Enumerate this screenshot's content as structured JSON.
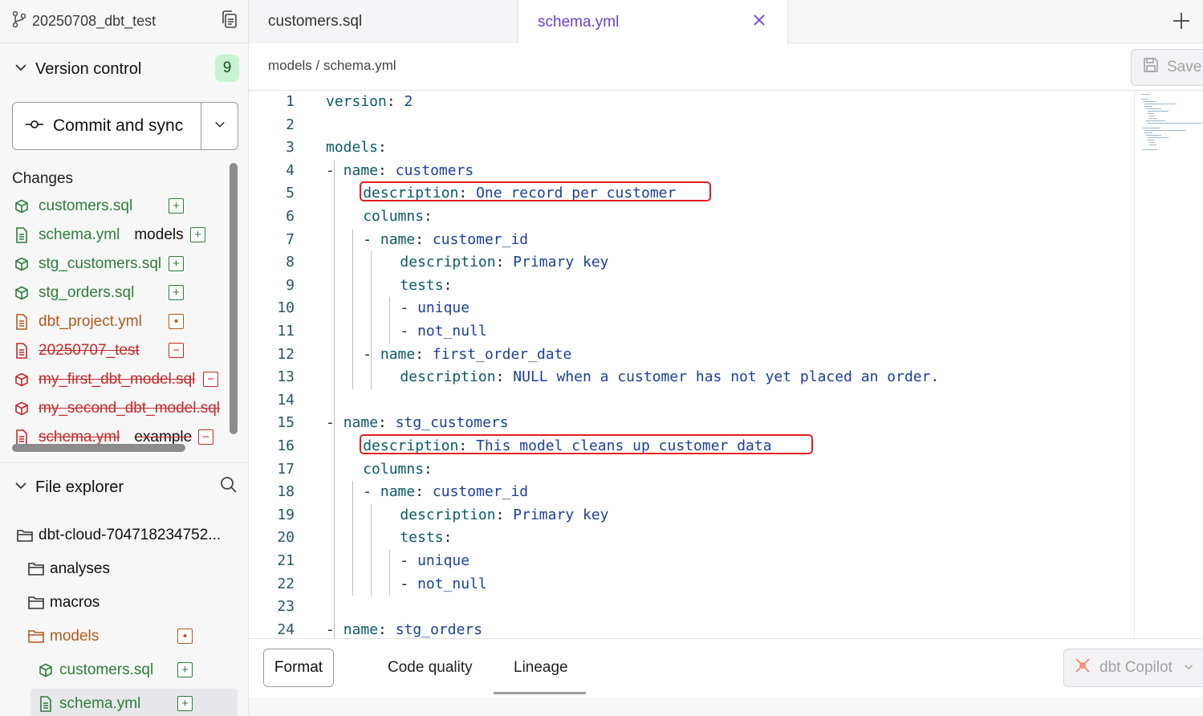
{
  "sidebar": {
    "branch": "20250708_dbt_test",
    "version_control": {
      "title": "Version control",
      "badge": "9"
    },
    "commit": {
      "label": "Commit and sync"
    },
    "changes": {
      "title": "Changes",
      "items": [
        {
          "name": "customers.sql",
          "folder": "",
          "state": "added",
          "kind": "model"
        },
        {
          "name": "schema.yml",
          "folder": "models",
          "state": "added",
          "kind": "file"
        },
        {
          "name": "stg_customers.sql",
          "folder": "",
          "state": "added",
          "kind": "model"
        },
        {
          "name": "stg_orders.sql",
          "folder": "",
          "state": "added",
          "kind": "model"
        },
        {
          "name": "dbt_project.yml",
          "folder": "",
          "state": "modified",
          "kind": "file"
        },
        {
          "name": "20250707_test",
          "folder": "",
          "state": "deleted",
          "kind": "file"
        },
        {
          "name": "my_first_dbt_model.sql",
          "folder": "",
          "state": "deleted",
          "kind": "model"
        },
        {
          "name": "my_second_dbt_model.sql",
          "folder": "",
          "state": "deleted",
          "kind": "model"
        },
        {
          "name": "schema.yml",
          "folder": "example",
          "state": "deleted",
          "kind": "file"
        }
      ]
    },
    "file_explorer": {
      "title": "File explorer",
      "root": "dbt-cloud-704718234752...",
      "items": [
        {
          "name": "analyses",
          "type": "folder",
          "state": ""
        },
        {
          "name": "macros",
          "type": "folder",
          "state": ""
        },
        {
          "name": "models",
          "type": "folder",
          "state": "modified"
        },
        {
          "name": "customers.sql",
          "type": "model",
          "state": "added"
        },
        {
          "name": "schema.yml",
          "type": "file",
          "state": "added"
        }
      ]
    }
  },
  "tabs": [
    {
      "label": "customers.sql",
      "active": false
    },
    {
      "label": "schema.yml",
      "active": true
    }
  ],
  "breadcrumb": "models / schema.yml",
  "toolbar": {
    "save_label": "Save"
  },
  "editor": {
    "lines": [
      {
        "n": "1",
        "indent": 0,
        "key": "version",
        "val": "2"
      },
      {
        "n": "2",
        "indent": 0,
        "key": "",
        "val": ""
      },
      {
        "n": "3",
        "indent": 0,
        "key": "models",
        "val": ""
      },
      {
        "n": "4",
        "indent": 1,
        "dash": true,
        "key": "name",
        "val": "customers"
      },
      {
        "n": "5",
        "indent": 2,
        "key": "description",
        "val": "One record per customer",
        "highlight": true
      },
      {
        "n": "6",
        "indent": 2,
        "key": "columns",
        "val": ""
      },
      {
        "n": "7",
        "indent": 3,
        "dash": true,
        "key": "name",
        "val": "customer_id"
      },
      {
        "n": "8",
        "indent": 4,
        "key": "description",
        "val": "Primary key"
      },
      {
        "n": "9",
        "indent": 4,
        "key": "tests",
        "val": ""
      },
      {
        "n": "10",
        "indent": 5,
        "dash": true,
        "key": "",
        "val": "unique"
      },
      {
        "n": "11",
        "indent": 5,
        "dash": true,
        "key": "",
        "val": "not_null"
      },
      {
        "n": "12",
        "indent": 3,
        "dash": true,
        "key": "name",
        "val": "first_order_date"
      },
      {
        "n": "13",
        "indent": 4,
        "key": "description",
        "val": "NULL when a customer has not yet placed an order."
      },
      {
        "n": "14",
        "indent": 0,
        "key": "",
        "val": ""
      },
      {
        "n": "15",
        "indent": 1,
        "dash": true,
        "key": "name",
        "val": "stg_customers"
      },
      {
        "n": "16",
        "indent": 2,
        "key": "description",
        "val": "This model cleans up customer data",
        "highlight": true
      },
      {
        "n": "17",
        "indent": 2,
        "key": "columns",
        "val": ""
      },
      {
        "n": "18",
        "indent": 3,
        "dash": true,
        "key": "name",
        "val": "customer_id"
      },
      {
        "n": "19",
        "indent": 4,
        "key": "description",
        "val": "Primary key"
      },
      {
        "n": "20",
        "indent": 4,
        "key": "tests",
        "val": ""
      },
      {
        "n": "21",
        "indent": 5,
        "dash": true,
        "key": "",
        "val": "unique"
      },
      {
        "n": "22",
        "indent": 5,
        "dash": true,
        "key": "",
        "val": "not_null"
      },
      {
        "n": "23",
        "indent": 0,
        "key": "",
        "val": ""
      },
      {
        "n": "24",
        "indent": 1,
        "dash": true,
        "key": "name",
        "val": "stg_orders"
      }
    ]
  },
  "bottom": {
    "format_label": "Format",
    "tabs": [
      "Code quality",
      "Lineage"
    ],
    "active_tab": "Lineage",
    "copilot_label": "dbt Copilot"
  },
  "colors": {
    "accent": "#6b3fd4",
    "added": "#2d7d3a",
    "modified": "#b5591a",
    "deleted": "#c62828",
    "yaml_key": "#0b5a66",
    "yaml_value": "#1c3f9e",
    "highlight_box": "#e02020"
  }
}
